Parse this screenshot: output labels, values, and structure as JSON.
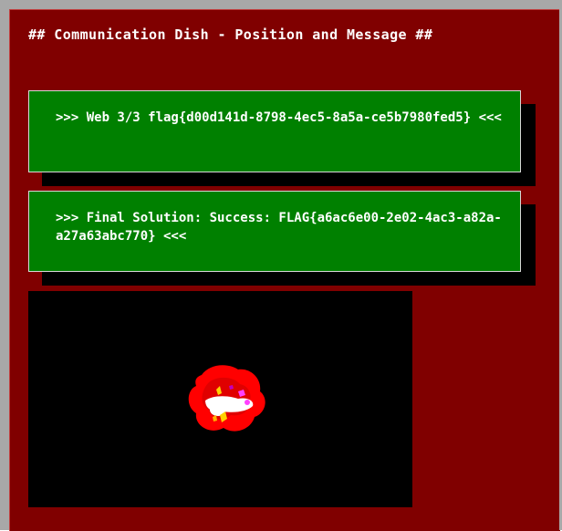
{
  "page": {
    "title": "## Communication Dish - Position and Message ##"
  },
  "messages": [
    {
      "text": ">>> Web 3/3 flag{d00d141d-8798-4ec5-8a5a-ce5b7980fed5} <<<"
    },
    {
      "text": ">>> Final Solution: Success: FLAG{a6ac6e00-2e02-4ac3-a82a-a27a63abc770} <<<"
    }
  ],
  "colors": {
    "background": "#800000",
    "message_box": "#008000",
    "viewport": "#000000",
    "text": "#ffffff"
  },
  "icons": {
    "dish": "communication-dish-sprite"
  }
}
